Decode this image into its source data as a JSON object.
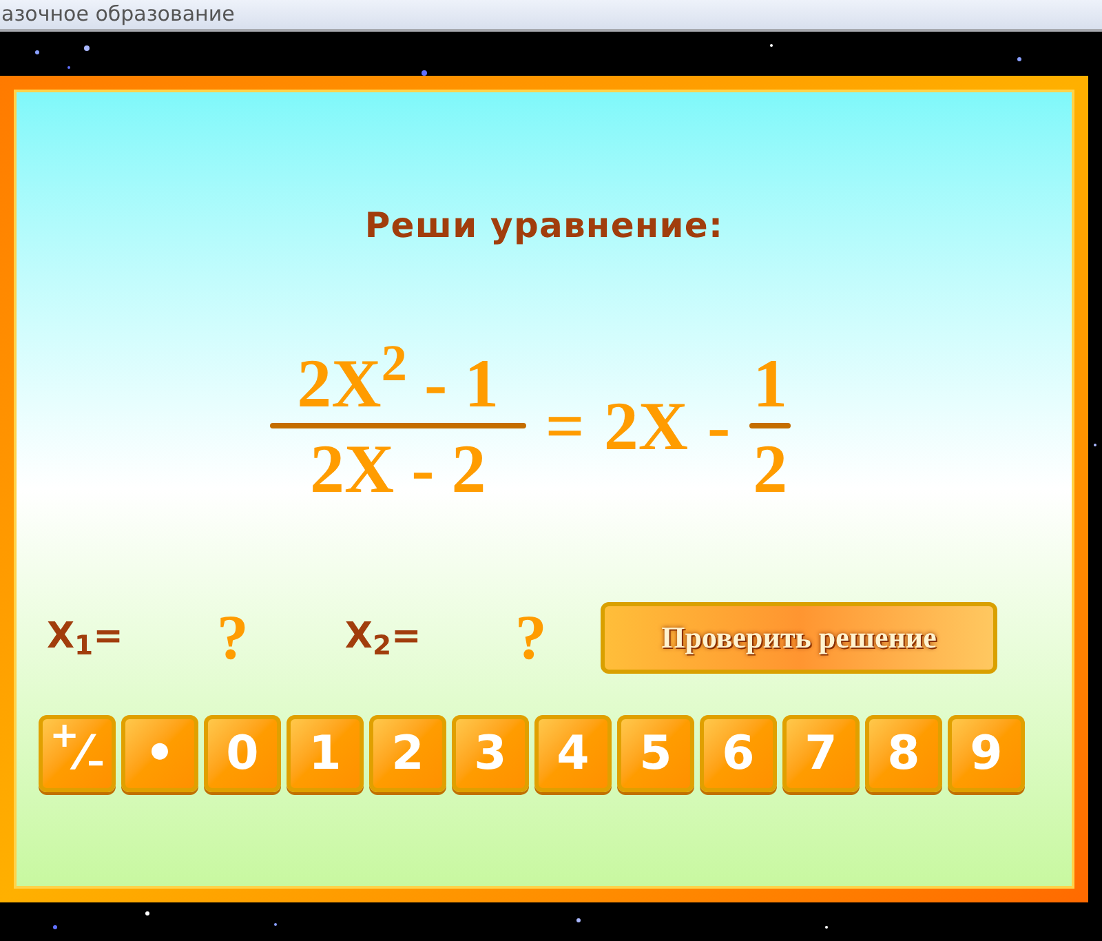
{
  "window": {
    "title": "азочное образование"
  },
  "prompt": "Реши уравнение:",
  "equation": {
    "left_numerator": "2X$^{2}$ - 1",
    "left_denominator": "2X - 2",
    "equals": "=",
    "right_term": "2X",
    "minus": "-",
    "right_numerator": "1",
    "right_denominator": "2"
  },
  "answers": [
    {
      "label": "X$_{1}$=",
      "value": "?"
    },
    {
      "label": "X$_{2}$=",
      "value": "?"
    }
  ],
  "check_button": "Проверить решение",
  "keypad": [
    {
      "label": "$^{+}$⁄$_{–}$"
    },
    {
      "label": "•"
    },
    {
      "label": "0"
    },
    {
      "label": "1"
    },
    {
      "label": "2"
    },
    {
      "label": "3"
    },
    {
      "label": "4"
    },
    {
      "label": "5"
    },
    {
      "label": "6"
    },
    {
      "label": "7"
    },
    {
      "label": "8"
    },
    {
      "label": "9"
    }
  ]
}
